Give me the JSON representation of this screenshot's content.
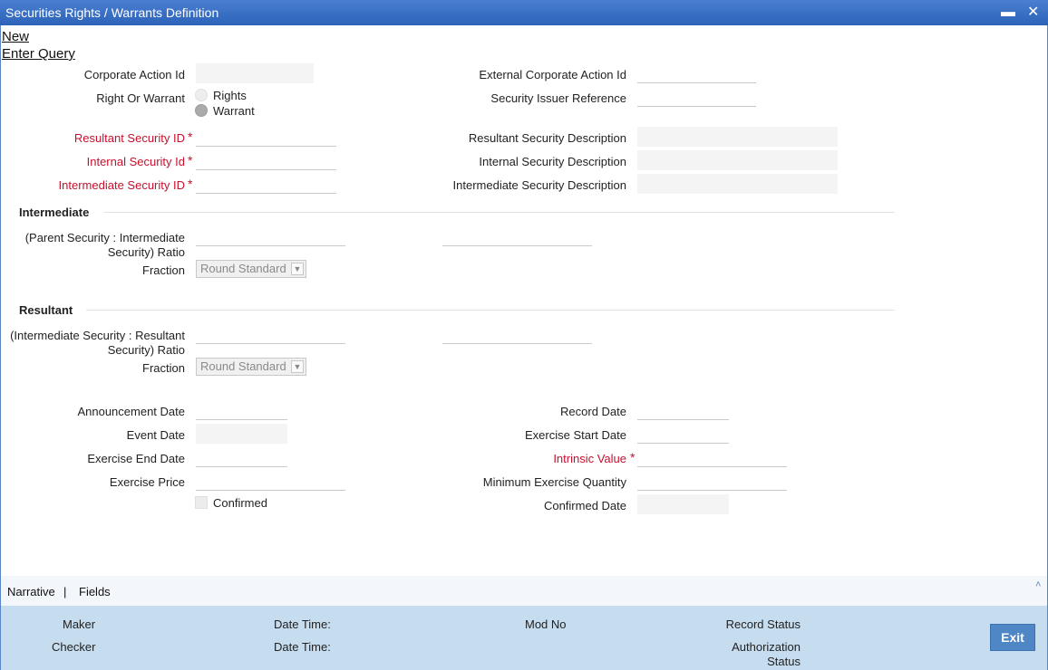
{
  "window": {
    "title": "Securities Rights / Warrants Definition",
    "minimize": "▬",
    "close": "✕"
  },
  "menu": {
    "new": "New",
    "enter_query": "Enter Query"
  },
  "form": {
    "corporate_action_id": {
      "label": "Corporate Action Id",
      "value": ""
    },
    "external_corporate_action_id": {
      "label": "External Corporate Action Id",
      "value": ""
    },
    "right_or_warrant": {
      "label": "Right Or Warrant",
      "options": [
        "Rights",
        "Warrant"
      ],
      "selected": "Warrant"
    },
    "security_issuer_reference": {
      "label": "Security Issuer Reference",
      "value": ""
    },
    "resultant_security_id": {
      "label": "Resultant Security ID",
      "value": ""
    },
    "resultant_security_description": {
      "label": "Resultant Security Description",
      "value": ""
    },
    "internal_security_id": {
      "label": "Internal Security Id",
      "value": ""
    },
    "internal_security_description": {
      "label": "Internal Security Description",
      "value": ""
    },
    "intermediate_security_id": {
      "label": "Intermediate Security ID",
      "value": ""
    },
    "intermediate_security_description": {
      "label": "Intermediate Security Description",
      "value": ""
    },
    "required_mark": "*"
  },
  "intermediate": {
    "heading": "Intermediate",
    "ratio_label_line1": "(Parent Security : Intermediate",
    "ratio_label_line2": "Security) Ratio",
    "fraction_label": "Fraction",
    "fraction_value": "Round Standard"
  },
  "resultant": {
    "heading": "Resultant",
    "ratio_label_line1": "(Intermediate Security : Resultant",
    "ratio_label_line2": "Security) Ratio",
    "fraction_label": "Fraction",
    "fraction_value": "Round Standard"
  },
  "dates": {
    "announcement_date": "Announcement Date",
    "record_date": "Record Date",
    "event_date": "Event Date",
    "exercise_start_date": "Exercise Start Date",
    "exercise_end_date": "Exercise End Date",
    "intrinsic_value": "Intrinsic Value",
    "exercise_price": "Exercise Price",
    "minimum_exercise_quantity": "Minimum Exercise Quantity",
    "confirmed": "Confirmed",
    "confirmed_date": "Confirmed Date"
  },
  "tabs": {
    "narrative": "Narrative",
    "separator": "|",
    "fields": "Fields",
    "collapse": "˄"
  },
  "footer": {
    "maker": "Maker",
    "checker": "Checker",
    "date_time_1": "Date Time:",
    "date_time_2": "Date Time:",
    "mod_no": "Mod No",
    "record_status": "Record Status",
    "authorization_status_line1": "Authorization",
    "authorization_status_line2": "Status",
    "exit": "Exit"
  },
  "colors": {
    "title_bar": "#2c63b8",
    "required": "#c8102e",
    "footer_bg": "#c6dcef",
    "exit_button": "#4f86c6"
  }
}
